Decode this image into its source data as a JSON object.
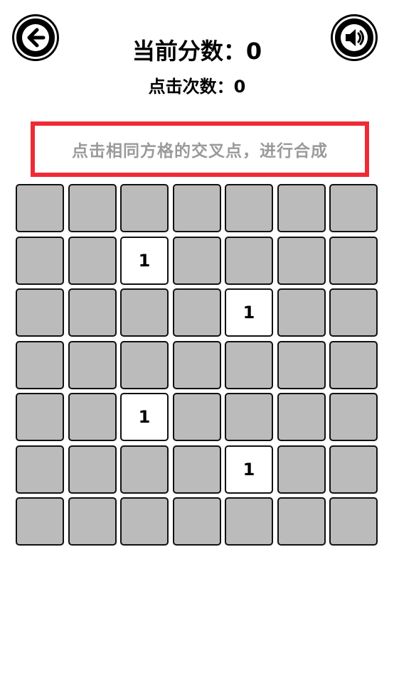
{
  "header": {
    "score_text": "当前分数：0",
    "clicks_text": "点击次数：0"
  },
  "instruction": "点击相同方格的交叉点，进行合成",
  "icons": {
    "back": "arrow-left-icon",
    "sound": "speaker-icon"
  },
  "colors": {
    "empty_cell": "#bbbbbb",
    "filled_cell": "#ffffff",
    "instruction_border": "#ee2b35",
    "instruction_text": "#9a9a9a"
  },
  "board": {
    "rows": 7,
    "cols": 7,
    "cells": [
      [
        "",
        "",
        "",
        "",
        "",
        "",
        ""
      ],
      [
        "",
        "",
        "1",
        "",
        "",
        "",
        ""
      ],
      [
        "",
        "",
        "",
        "",
        "1",
        "",
        ""
      ],
      [
        "",
        "",
        "",
        "",
        "",
        "",
        ""
      ],
      [
        "",
        "",
        "1",
        "",
        "",
        "",
        ""
      ],
      [
        "",
        "",
        "",
        "",
        "1",
        "",
        ""
      ],
      [
        "",
        "",
        "",
        "",
        "",
        "",
        ""
      ]
    ]
  }
}
